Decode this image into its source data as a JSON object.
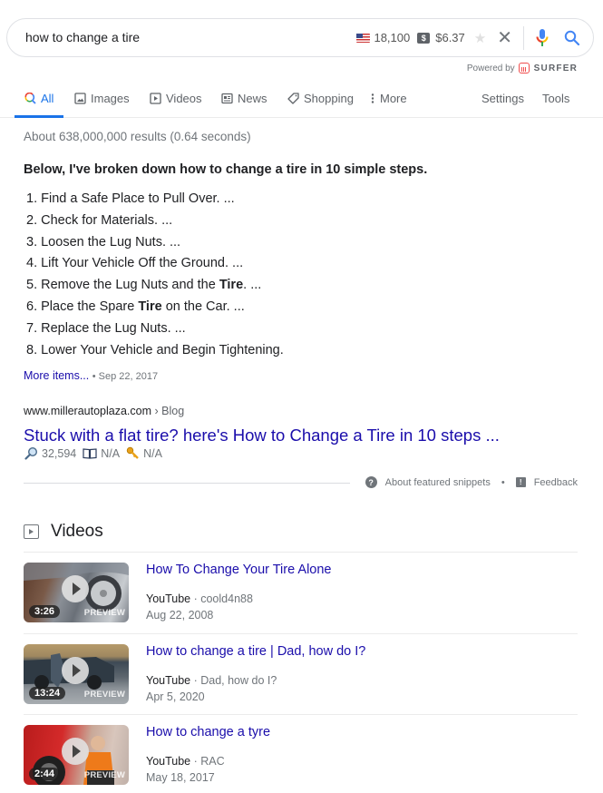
{
  "search": {
    "query": "how to change a tire",
    "search_volume": "18,100",
    "cpc": "$6.37",
    "dollar_badge": "$",
    "powered_by": "Powered by",
    "surfer": "SURFER"
  },
  "tabs": [
    {
      "label": "All",
      "icon": "search-icon",
      "active": true
    },
    {
      "label": "Images",
      "icon": "image-icon"
    },
    {
      "label": "Videos",
      "icon": "video-icon"
    },
    {
      "label": "News",
      "icon": "news-icon"
    },
    {
      "label": "Shopping",
      "icon": "tag-icon"
    },
    {
      "label": "More",
      "icon": "more-vert-icon"
    }
  ],
  "tools": {
    "settings": "Settings",
    "tools": "Tools"
  },
  "stats": "About 638,000,000 results (0.64 seconds)",
  "featured_snippet": {
    "heading": "Below, I've broken down how to change a tire in 10 simple steps.",
    "steps": [
      {
        "pre": "1. Find a Safe Place to Pull Over. ...",
        "bold": "",
        "post": ""
      },
      {
        "pre": "2. Check for Materials. ...",
        "bold": "",
        "post": ""
      },
      {
        "pre": "3. Loosen the Lug Nuts. ...",
        "bold": "",
        "post": ""
      },
      {
        "pre": "4. Lift Your Vehicle Off the Ground. ...",
        "bold": "",
        "post": ""
      },
      {
        "pre": "5. Remove the Lug Nuts and the ",
        "bold": "Tire",
        "post": ". ..."
      },
      {
        "pre": "6. Place the Spare ",
        "bold": "Tire",
        "post": " on the Car. ..."
      },
      {
        "pre": "7. Replace the Lug Nuts. ...",
        "bold": "",
        "post": ""
      },
      {
        "pre": "8. Lower Your Vehicle and Begin Tightening.",
        "bold": "",
        "post": ""
      }
    ],
    "more_items": "More items...",
    "bullet": "•",
    "date": "Sep 22, 2017",
    "cite_domain": "www.millerautoplaza.com",
    "cite_crumb": " › Blog",
    "title": "Stuck with a flat tire? here's How to Change a Tire in 10 steps ...",
    "metrics": {
      "visits": "32,594",
      "pages": "N/A",
      "keywords": "N/A"
    },
    "about": "About featured snippets",
    "feedback": "Feedback",
    "sep": "•"
  },
  "videos": {
    "heading": "Videos",
    "items": [
      {
        "title": "How To Change Your Tire Alone",
        "source": "YouTube",
        "channel": " · coold4n88",
        "date": "Aug 22, 2008",
        "duration": "3:26",
        "preview": "PREVIEW"
      },
      {
        "title": "How to change a tire | Dad, how do I?",
        "source": "YouTube",
        "channel": " · Dad, how do I?",
        "date": "Apr 5, 2020",
        "duration": "13:24",
        "preview": "PREVIEW"
      },
      {
        "title": "How to change a tyre",
        "source": "YouTube",
        "channel": " · RAC",
        "date": "May 18, 2017",
        "duration": "2:44",
        "preview": "PREVIEW"
      }
    ]
  }
}
